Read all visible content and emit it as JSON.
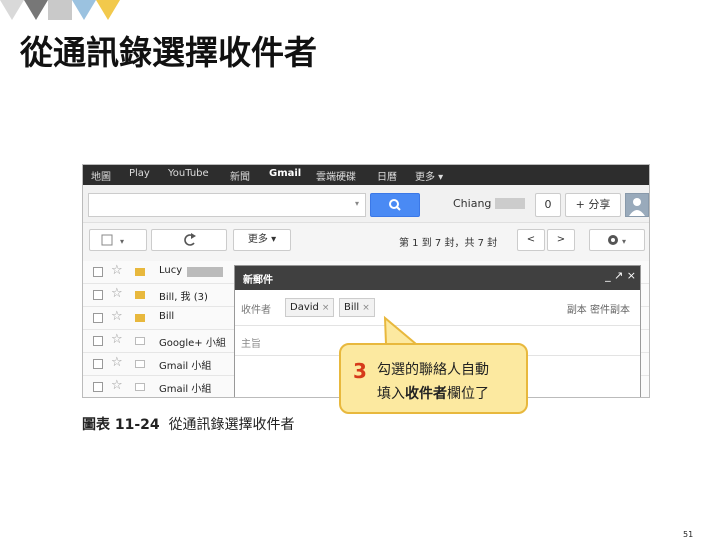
{
  "slide": {
    "title": "從通訊錄選擇收件者",
    "page_number": "51"
  },
  "topbar": {
    "items": [
      "地圖",
      "Play",
      "YouTube",
      "新聞",
      "Gmail",
      "雲端硬碟",
      "日曆",
      "更多 ▾"
    ]
  },
  "search": {
    "dropdown": "▾",
    "user": "Chiang",
    "count": "0",
    "share": "+ 分享"
  },
  "toolbar": {
    "select_arrow": "▾",
    "refresh": "C",
    "more": "更多 ▾",
    "pager": "第 1 到 7 封，共 7 封",
    "prev": "<",
    "next": ">",
    "settings_arrow": "▾"
  },
  "mail_rows": [
    {
      "sender": "Lucy",
      "tag_color": "#e8b83d"
    },
    {
      "sender": "Bill, 我 (3)",
      "tag_color": "#e8b83d"
    },
    {
      "sender": "Bill",
      "tag_color": "#e8b83d"
    },
    {
      "sender": "Google+ 小組",
      "tag_color": "#ffffff"
    },
    {
      "sender": "Gmail 小組",
      "tag_color": "#ffffff"
    },
    {
      "sender": "Gmail 小組",
      "tag_color": "#ffffff"
    }
  ],
  "compose": {
    "title": "新郵件",
    "controls": "_ ↗ ×",
    "to_label": "收件者",
    "recipients": [
      "David",
      "Bill"
    ],
    "remove": "×",
    "cc_bcc": "副本 密件副本",
    "subject_placeholder": "主旨"
  },
  "callout": {
    "step": "3",
    "line1": "勾選的聯絡人自動",
    "line2_prefix": "填入",
    "line2_bold": "收件者",
    "line2_suffix": "欄位了"
  },
  "caption": {
    "figure": "圖表 11-24",
    "text": "從通訊錄選擇收件者"
  },
  "colors": {
    "accent_blue": "#4a8af4",
    "callout_bg": "#fce9a0",
    "callout_border": "#e8b83d",
    "step_red": "#d63a1a"
  }
}
